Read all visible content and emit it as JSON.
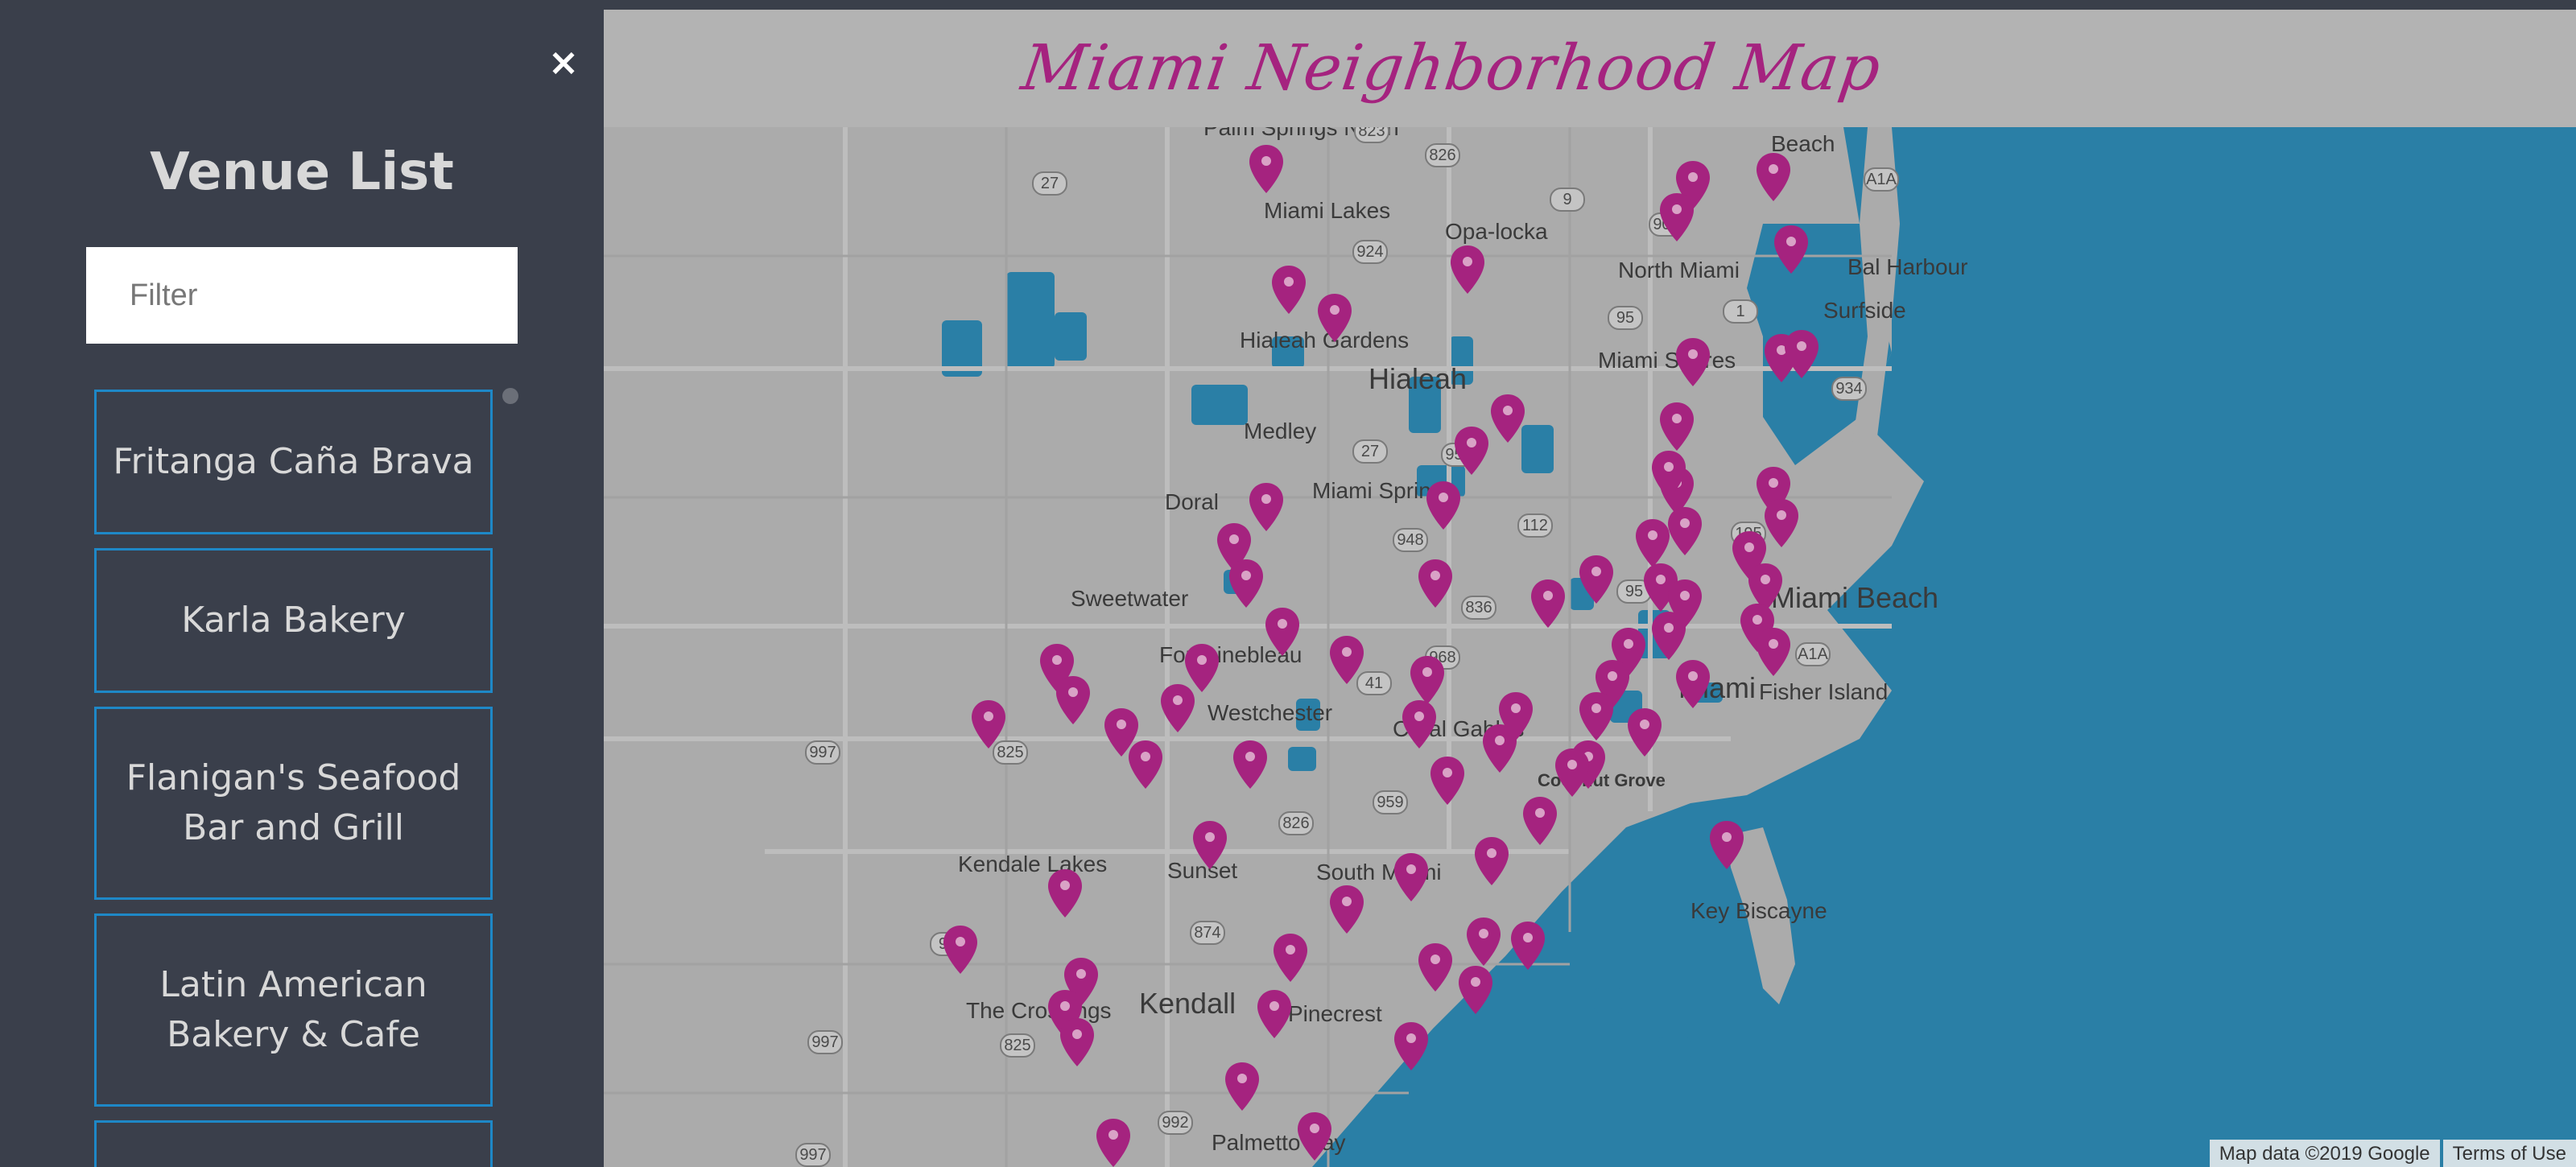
{
  "sidebar": {
    "close_label": "×",
    "title": "Venue List",
    "filter_placeholder": "Filter",
    "venues": [
      {
        "label": "Fritanga Caña Brava"
      },
      {
        "label": "Karla Bakery"
      },
      {
        "label": "Flanigan's Seafood Bar and Grill"
      },
      {
        "label": "Latin American Bakery & Cafe"
      }
    ]
  },
  "header": {
    "title": "Miami Neighborhood Map"
  },
  "map": {
    "places": [
      {
        "label": "Palm Springs North"
      },
      {
        "label": "Miami Lakes"
      },
      {
        "label": "Opa-locka"
      },
      {
        "label": "North Miami"
      },
      {
        "label": "Beach"
      },
      {
        "label": "Bal Harbour"
      },
      {
        "label": "Surfside"
      },
      {
        "label": "Hialeah Gardens"
      },
      {
        "label": "Hialeah"
      },
      {
        "label": "Miami Shores"
      },
      {
        "label": "Medley"
      },
      {
        "label": "Doral"
      },
      {
        "label": "Miami Springs"
      },
      {
        "label": "Miami Beach"
      },
      {
        "label": "Sweetwater"
      },
      {
        "label": "Fontainebleau"
      },
      {
        "label": "Miami"
      },
      {
        "label": "Fisher Island"
      },
      {
        "label": "Westchester"
      },
      {
        "label": "Coral Gables"
      },
      {
        "label": "Coconut Grove"
      },
      {
        "label": "Kendale Lakes"
      },
      {
        "label": "Sunset"
      },
      {
        "label": "South Miami"
      },
      {
        "label": "Key Biscayne"
      },
      {
        "label": "The Crossings"
      },
      {
        "label": "Kendall"
      },
      {
        "label": "Pinecrest"
      },
      {
        "label": "Palmetto Bay"
      }
    ],
    "shields": [
      "823",
      "826",
      "27",
      "9",
      "909",
      "A1A",
      "924",
      "95",
      "1",
      "934",
      "27",
      "953",
      "112",
      "195",
      "948",
      "836",
      "968",
      "41",
      "997",
      "825",
      "959",
      "826",
      "874",
      "94",
      "997",
      "825",
      "992",
      "997",
      "A1A",
      "95"
    ],
    "marker_color": "#a5237f",
    "water_color": "#2a7fa6",
    "footer_data": "Map data ©2019 Google",
    "footer_terms": "Terms of Use"
  }
}
